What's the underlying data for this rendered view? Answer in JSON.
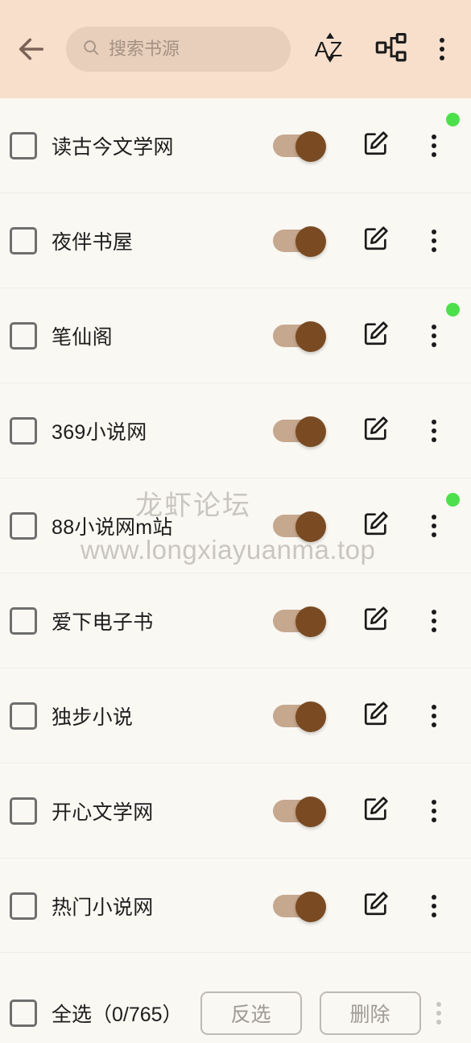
{
  "header": {
    "back_icon": "arrow-left-icon",
    "search": {
      "placeholder": "搜索书源",
      "value": "",
      "icon": "search-icon"
    },
    "sort_icon_label": "AZ",
    "sort_icon_name": "sort-az-icon",
    "group_icon_name": "source-group-icon",
    "overflow_icon_name": "more-vertical-icon"
  },
  "colors": {
    "header_bg": "#F8DFCC",
    "search_bg": "#E7CFBB",
    "list_bg": "#FAF8F3",
    "toggle_thumb": "#7A4B23",
    "toggle_track": "#C6A88F",
    "badge_green": "#4CE04C",
    "divider": "#F0EDE6",
    "text_primary": "#1d1d1d",
    "text_muted": "#9E9A94"
  },
  "list": {
    "rows": [
      {
        "name": "读古今文学网",
        "checked": false,
        "enabled": true,
        "badge": true
      },
      {
        "name": "夜伴书屋",
        "checked": false,
        "enabled": true,
        "badge": false
      },
      {
        "name": "笔仙阁",
        "checked": false,
        "enabled": true,
        "badge": true
      },
      {
        "name": "369小说网",
        "checked": false,
        "enabled": true,
        "badge": false
      },
      {
        "name": "88小说网m站",
        "checked": false,
        "enabled": true,
        "badge": true
      },
      {
        "name": "爱下电子书",
        "checked": false,
        "enabled": true,
        "badge": false
      },
      {
        "name": "独步小说",
        "checked": false,
        "enabled": true,
        "badge": false
      },
      {
        "name": "开心文学网",
        "checked": false,
        "enabled": true,
        "badge": false
      },
      {
        "name": "热门小说网",
        "checked": false,
        "enabled": true,
        "badge": false
      }
    ]
  },
  "watermark": {
    "line1": "龙虾论坛",
    "line2": "www.longxiayuanma.top"
  },
  "bottombar": {
    "select_all_label": "全选（0/765）",
    "selected_count": 0,
    "total_count": 765,
    "invert_label": "反选",
    "delete_label": "删除",
    "overflow_icon_name": "more-vertical-icon"
  }
}
